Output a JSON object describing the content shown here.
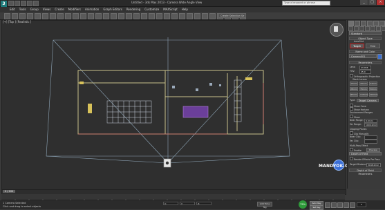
{
  "window": {
    "title": "Untitled - 3ds Max 2013 - Camera Wide Angle View",
    "search_placeholder": "Type a keyword or phrase",
    "controls": [
      "_",
      "□",
      "×"
    ]
  },
  "menu": [
    "Edit",
    "Tools",
    "Group",
    "Views",
    "Create",
    "Modifiers",
    "Animation",
    "Graph Editors",
    "Rendering",
    "Customize",
    "MAXScript",
    "Help"
  ],
  "toolbar": {
    "dropdown_value": "Create Selection Se"
  },
  "viewport": {
    "label": "[+] [Top ] [Realistic ]"
  },
  "command_panel": {
    "category": "Standard",
    "object_type_header": "Object Type",
    "autogrid_label": "AutoGrid",
    "camera_button": "Target",
    "free_button": "Free",
    "name_color_header": "Name and Color",
    "name_value": "Camera001",
    "parameters_header": "Parameters",
    "lens_label": "Lens:",
    "lens_value": "43.456",
    "fov_label": "FOV:",
    "fov_value": "45.0",
    "ortho_label": "Orthographic Projection",
    "stock_lenses_header": "Stock Lenses",
    "stock_lenses": [
      "15mm",
      "20mm",
      "24mm",
      "28mm",
      "35mm",
      "50mm",
      "85mm",
      "135mm",
      "200mm"
    ],
    "type_label": "Type:",
    "type_value": "Target Camera",
    "show_cone": "Show Cone",
    "show_horizon": "Show Horizon",
    "env_ranges_header": "Environment Ranges",
    "env_show": "Show",
    "near_range_label": "Near Range:",
    "near_range_value": "0.0mm",
    "far_range_label": "Far Range:",
    "far_range_value": "1000.0mm",
    "clipping_header": "Clipping Planes",
    "clip_manually": "Clip Manually",
    "near_clip_label": "Near Clip:",
    "far_clip_label": "Far Clip:",
    "multipass_header": "Multi-Pass Effect",
    "enable_label": "Enable",
    "preview_label": "Preview",
    "dof_value": "Depth of Field",
    "render_effects": "Render Effects Per Pass",
    "target_distance_label": "Target Distance:",
    "target_distance_value": "3048.0mm",
    "dof_params_header": "Depth of Field Parameters"
  },
  "timeline": {
    "slider": "0 / 100"
  },
  "status": {
    "selection": "1 Camera Selected",
    "prompt": "Click and drag to select objects",
    "x": "X:",
    "y": "Y:",
    "z": "Z:",
    "add_time_tag": "Add Time Tag",
    "auto_key": "Auto Key",
    "set_key": "Set Key",
    "record": "75%",
    "frame": "0"
  },
  "watermark": "MANDYOK.COM",
  "colors": {
    "highlight": "#c01818",
    "scene_lines": "#b8a36a",
    "walls": "#c9c28b",
    "cone": "#8fa6b8"
  }
}
